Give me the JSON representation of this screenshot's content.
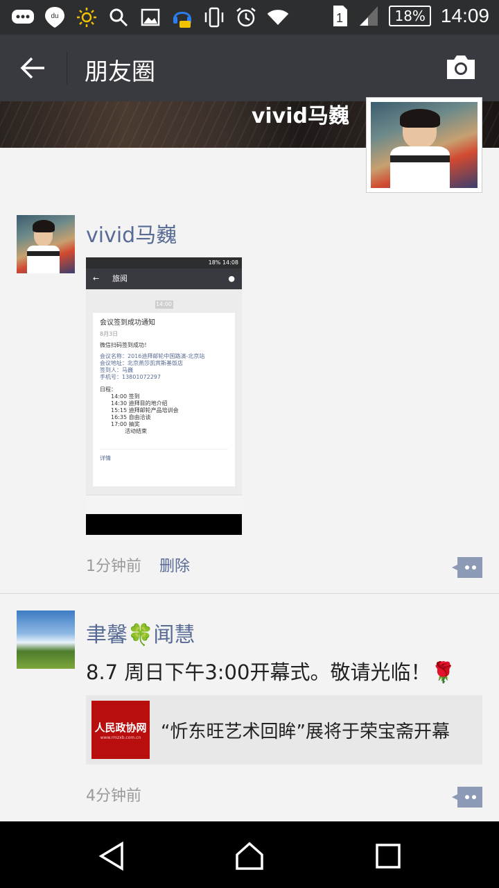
{
  "status_bar": {
    "time": "14:09",
    "battery": "18%",
    "sim_slot": "1",
    "icons": [
      "chat-bubble-icon",
      "baidu-map-icon",
      "brightness-icon",
      "search-icon",
      "gallery-icon",
      "headset-icon",
      "vibrate-icon",
      "alarm-icon",
      "wifi-icon",
      "sim-icon",
      "signal-icon",
      "battery-icon"
    ]
  },
  "header": {
    "title": "朋友圈",
    "back_icon": "back-arrow-icon",
    "camera_icon": "camera-icon"
  },
  "profile": {
    "name": "vivid马巍"
  },
  "posts": [
    {
      "author": "vivid马巍",
      "time": "1分钟前",
      "delete_label": "删除",
      "screenshot": {
        "status_time": "14:08",
        "status_battery": "18%",
        "title": "旅阅",
        "time_badge": "14:00",
        "card_title": "会议签到成功通知",
        "card_date": "8月3日",
        "line1": "微信扫码签到成功！",
        "field1": "会议名称：2016迪拜邮轮中国路演-北京站",
        "field2": "会议地址：北京燕莎凯宾斯基饭店",
        "field3": "签到人：马巍",
        "field4": "手机号：13801072297",
        "schedule_label": "日程：",
        "schedule": [
          "14:00 签到",
          "14:30 迪拜目的地介绍",
          "15:15 迪拜邮轮产品培训会",
          "16:35 自由洽谈",
          "17:00 抽奖",
          "活动结束"
        ],
        "details": "详情"
      }
    },
    {
      "author": "聿馨🍀闻慧",
      "text": "8.7 周日下午3:00开幕式。敬请光临！🌹",
      "time": "4分钟前",
      "share": {
        "thumb_title": "人民政协网",
        "thumb_sub": "www.rmzxb.com.cn",
        "text": "“忻东旺艺术回眸”展将于荣宝斋开幕"
      }
    }
  ],
  "nav": {
    "icons": [
      "nav-back-icon",
      "nav-home-icon",
      "nav-recents-icon"
    ]
  },
  "colors": {
    "link": "#576b95",
    "titlebar": "#393a3f",
    "statusbar": "#2c2e30"
  }
}
